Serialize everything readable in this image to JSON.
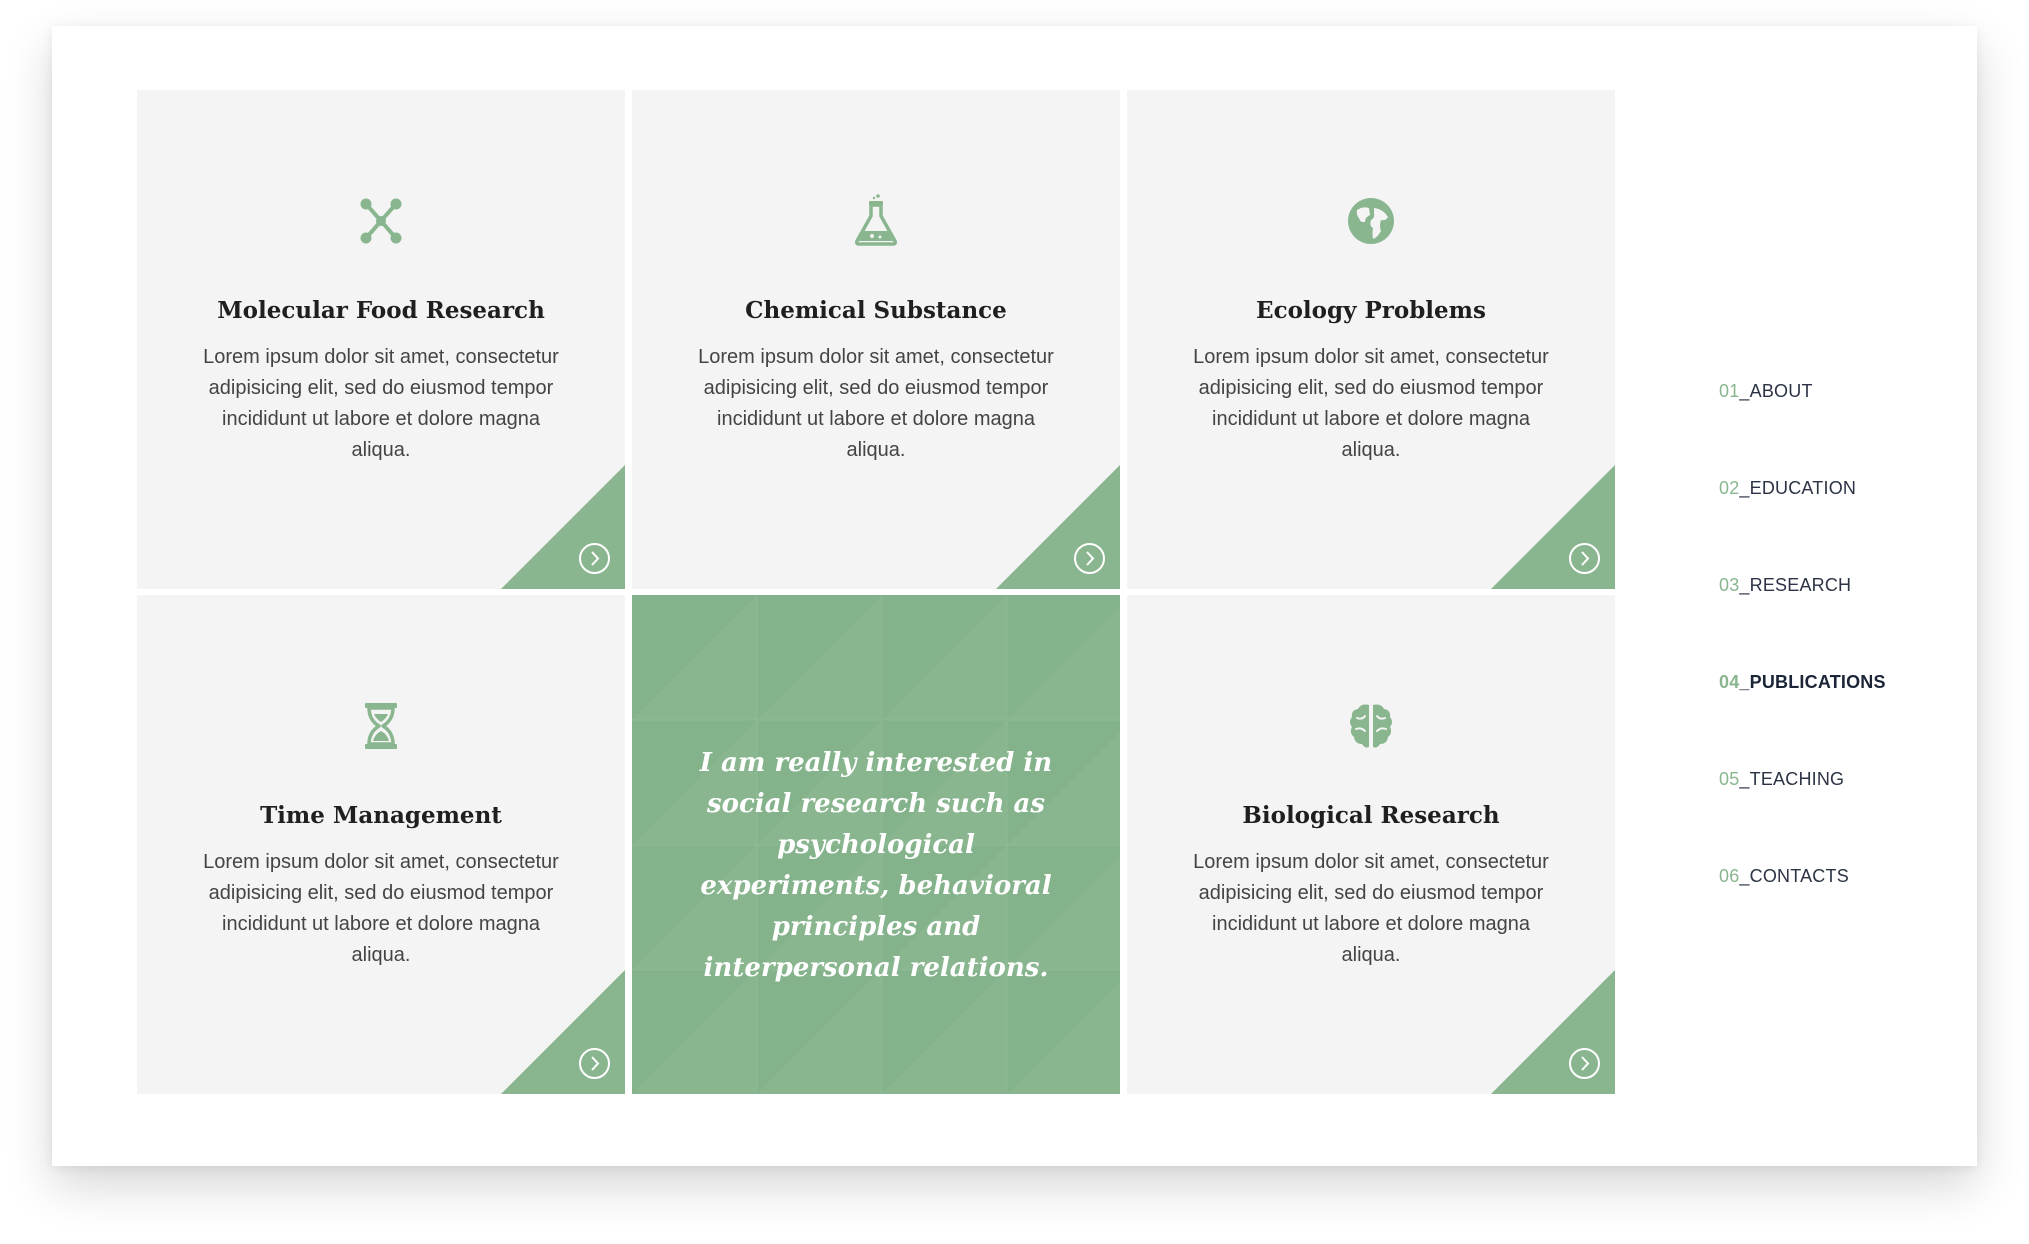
{
  "colors": {
    "accent": "#89b68f",
    "card_bg": "#f4f4f4",
    "heading": "#1f1f1f",
    "body_text": "#444444",
    "nav_text": "#2b3344"
  },
  "cards": [
    {
      "icon": "molecule-icon",
      "title": "Molecular Food Research",
      "text": "Lorem ipsum dolor sit amet, consectetur adipisicing elit, sed do eiusmod tempor incididunt ut labore et dolore magna aliqua."
    },
    {
      "icon": "flask-icon",
      "title": "Chemical Substance",
      "text": "Lorem ipsum dolor sit amet, consectetur adipisicing elit, sed do eiusmod tempor incididunt ut labore et dolore magna aliqua."
    },
    {
      "icon": "globe-icon",
      "title": "Ecology Problems",
      "text": "Lorem ipsum dolor sit amet, consectetur adipisicing elit, sed do eiusmod tempor incididunt ut labore et dolore magna aliqua."
    },
    {
      "icon": "hourglass-icon",
      "title": "Time Management",
      "text": "Lorem ipsum dolor sit amet, consectetur adipisicing elit, sed do eiusmod tempor incididunt ut labore et dolore magna aliqua."
    },
    {
      "icon": "brain-icon",
      "title": "Biological Research",
      "text": "Lorem ipsum dolor sit amet, consectetur adipisicing elit, sed do eiusmod tempor incididunt ut labore et dolore magna aliqua."
    }
  ],
  "quote": {
    "text": "I am really interested in social research such as psychological experiments, behavioral principles and interpersonal relations."
  },
  "nav": {
    "items": [
      {
        "num": "01",
        "label": "_ABOUT"
      },
      {
        "num": "02",
        "label": "_EDUCATION"
      },
      {
        "num": "03",
        "label": "_RESEARCH"
      },
      {
        "num": "04",
        "label": "_PUBLICATIONS"
      },
      {
        "num": "05",
        "label": "_TEACHING"
      },
      {
        "num": "06",
        "label": "_CONTACTS"
      }
    ],
    "active_index": 3
  }
}
